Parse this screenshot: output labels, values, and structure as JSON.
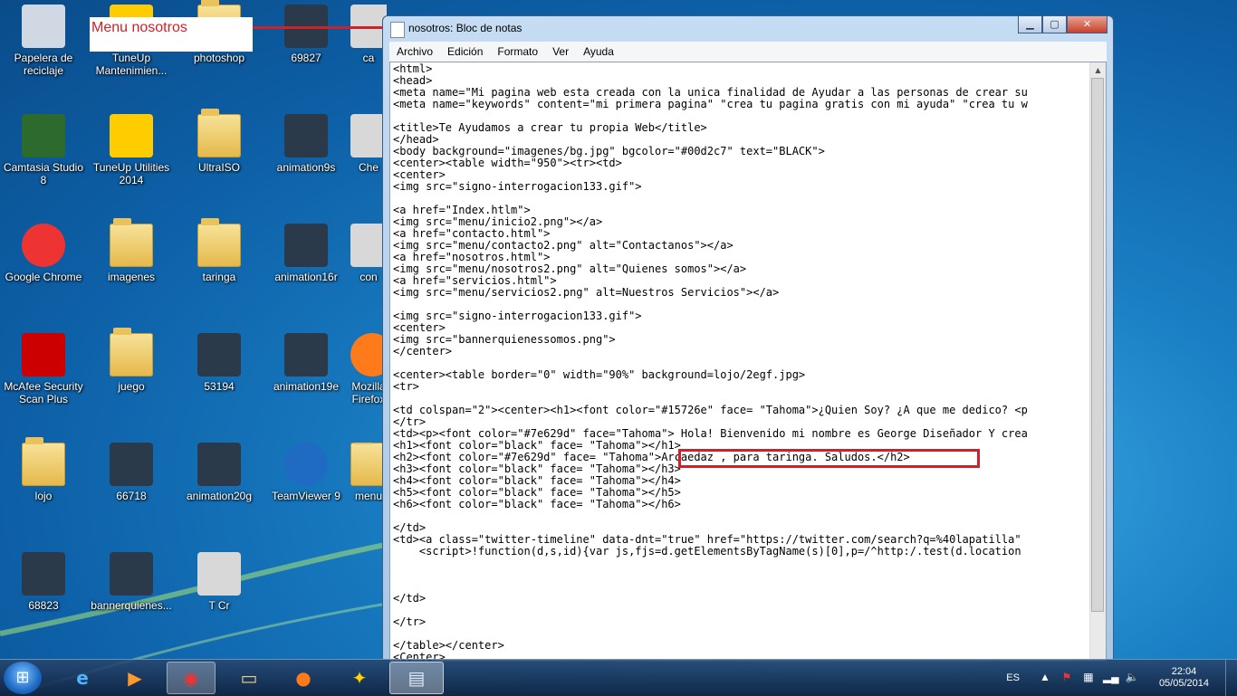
{
  "annotation": {
    "label": "Menu nosotros"
  },
  "desktop_icons": [
    {
      "label": "Papelera de reciclaje",
      "icon": "recycle-bin-icon"
    },
    {
      "label": "TuneUp Mantenimien...",
      "icon": "tuneup-icon"
    },
    {
      "label": "photoshop",
      "icon": "folder-icon"
    },
    {
      "label": "69827",
      "icon": "image-icon"
    },
    {
      "label": "ca",
      "icon": "app-icon"
    },
    {
      "label": "Camtasia Studio 8",
      "icon": "camtasia-icon"
    },
    {
      "label": "TuneUp Utilities 2014",
      "icon": "tuneup-icon"
    },
    {
      "label": "UltraISO",
      "icon": "folder-icon"
    },
    {
      "label": "animation9s",
      "icon": "image-icon"
    },
    {
      "label": "Che",
      "icon": "app-icon"
    },
    {
      "label": "Google Chrome",
      "icon": "chrome-icon"
    },
    {
      "label": "imagenes",
      "icon": "folder-icon"
    },
    {
      "label": "taringa",
      "icon": "folder-icon"
    },
    {
      "label": "animation16r",
      "icon": "image-icon"
    },
    {
      "label": "con",
      "icon": "app-icon"
    },
    {
      "label": "McAfee Security Scan Plus",
      "icon": "mcafee-icon"
    },
    {
      "label": "juego",
      "icon": "folder-icon"
    },
    {
      "label": "53194",
      "icon": "image-icon"
    },
    {
      "label": "animation19e",
      "icon": "image-icon"
    },
    {
      "label": "Mozilla Firefox",
      "icon": "firefox-icon"
    },
    {
      "label": "lojo",
      "icon": "folder-icon"
    },
    {
      "label": "66718",
      "icon": "image-icon"
    },
    {
      "label": "animation20g",
      "icon": "image-icon"
    },
    {
      "label": "TeamViewer 9",
      "icon": "teamviewer-icon"
    },
    {
      "label": "menu",
      "icon": "folder-icon"
    },
    {
      "label": "68823",
      "icon": "image-icon"
    },
    {
      "label": "bannerquienes...",
      "icon": "image-icon"
    },
    {
      "label": "T Cr",
      "icon": "app-icon"
    }
  ],
  "notepad": {
    "title": "nosotros: Bloc de notas",
    "menu": [
      "Archivo",
      "Edición",
      "Formato",
      "Ver",
      "Ayuda"
    ],
    "buttons": {
      "minimize": "▁",
      "maximize": "▢",
      "close": "✕"
    },
    "lines": [
      "<html>",
      "<head>",
      "<meta name=\"Mi pagina web esta creada con la unica finalidad de Ayudar a las personas de crear su",
      "<meta name=\"keywords\" content=\"mi primera pagina\" \"crea tu pagina gratis con mi ayuda\" \"crea tu w",
      "",
      "<title>Te Ayudamos a crear tu propia Web</title>",
      "</head>",
      "<body background=\"imagenes/bg.jpg\" bgcolor=\"#00d2c7\" text=\"BLACK\">",
      "<center><table width=\"950\"><tr><td>",
      "<center>",
      "<img src=\"signo-interrogacion133.gif\">",
      "",
      "<a href=\"Index.htlm\">",
      "<img src=\"menu/inicio2.png\"></a>",
      "<a href=\"contacto.html\">",
      "<img src=\"menu/contacto2.png\" alt=\"Contactanos\"></a>",
      "<a href=\"nosotros.html\">",
      "<img src=\"menu/nosotros2.png\" alt=\"Quienes somos\"></a>",
      "<a href=\"servicios.html\">",
      "<img src=\"menu/servicios2.png\" alt=Nuestros Servicios\"></a>",
      "",
      "<img src=\"signo-interrogacion133.gif\">",
      "<center>",
      "<img src=\"bannerquienessomos.png\">",
      "</center>",
      "",
      "<center><table border=\"0\" width=\"90%\" background=lojo/2egf.jpg>",
      "<tr>",
      "",
      "<td colspan=\"2\"><center><h1><font color=\"#15726e\" face= \"Tahoma\">¿Quien Soy? ¿A que me dedico? <p",
      "</tr>",
      "<td><p><font color=\"#7e629d\" face=\"Tahoma\"> Hola! Bienvenido mi nombre es George Diseñador Y crea",
      "<h1><font color=\"black\" face= \"Tahoma\"></h1>",
      "<h2><font color=\"#7e629d\" face= \"Tahoma\">Arcaedaz , para taringa. Saludos.</h2>",
      "<h3><font color=\"black\" face= \"Tahoma\"></h3>",
      "<h4><font color=\"black\" face= \"Tahoma\"></h4>",
      "<h5><font color=\"black\" face= \"Tahoma\"></h5>",
      "<h6><font color=\"black\" face= \"Tahoma\"></h6>",
      "",
      "</td>",
      "<td><a class=\"twitter-timeline\" data-dnt=\"true\" href=\"https://twitter.com/search?q=%40lapatilla\"",
      "    <script>!function(d,s,id){var js,fjs=d.getElementsByTagName(s)[0],p=/^http:/.test(d.location",
      "",
      "",
      "",
      "</td>",
      "",
      "</tr>",
      "",
      "</table></center>",
      "<Center>"
    ]
  },
  "taskbar": {
    "start_icon": "windows-start-icon",
    "pinned": [
      "internet-explorer-icon",
      "media-player-icon",
      "chrome-icon",
      "file-explorer-icon",
      "firefox-icon",
      "tuneup-icon",
      "notepad-icon"
    ],
    "language": "ES",
    "time": "22:04",
    "date": "05/05/2014"
  }
}
